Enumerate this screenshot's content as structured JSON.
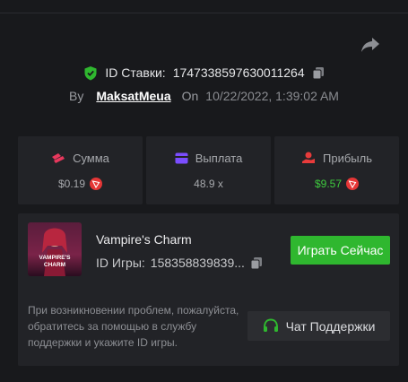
{
  "bet": {
    "id_label": "ID Ставки:",
    "id_value": "1747338597630011264",
    "by_label": "By",
    "username": "MaksatMeua",
    "on_label": "On",
    "date": "10/22/2022, 1:39:02 AM"
  },
  "stats": {
    "amount": {
      "label": "Сумма",
      "value": "$0.19"
    },
    "payout": {
      "label": "Выплата",
      "value": "48.9 x"
    },
    "profit": {
      "label": "Прибыль",
      "value": "$9.57"
    }
  },
  "game": {
    "name": "Vampire's Charm",
    "thumb_text": "VAMPIRE'S CHARM",
    "id_label": "ID Игры:",
    "id_value": "158358839839...",
    "play_label": "Играть Сейчас"
  },
  "support": {
    "help_text": "При возникновении проблем, пожалуйста, обратитесь за помощью в службу поддержки и укажите ID игры.",
    "button_label": "Чат Поддержки"
  },
  "colors": {
    "background": "#18191c",
    "card": "#222327",
    "accent_green": "#2fb72f",
    "profit_green": "#3ecb3e",
    "shield_green": "#2fb72f",
    "amount_icon": "#e8385d",
    "payout_icon": "#7b4dff",
    "profit_icon": "#e83b3b",
    "trx_red": "#e53636"
  },
  "icons": {
    "share": "share-icon",
    "shield": "shield-check-icon",
    "copy": "copy-icon",
    "amount": "coins-icon",
    "payout": "wallet-icon",
    "profit": "profit-icon",
    "currency": "tron-icon",
    "support": "headset-icon"
  }
}
